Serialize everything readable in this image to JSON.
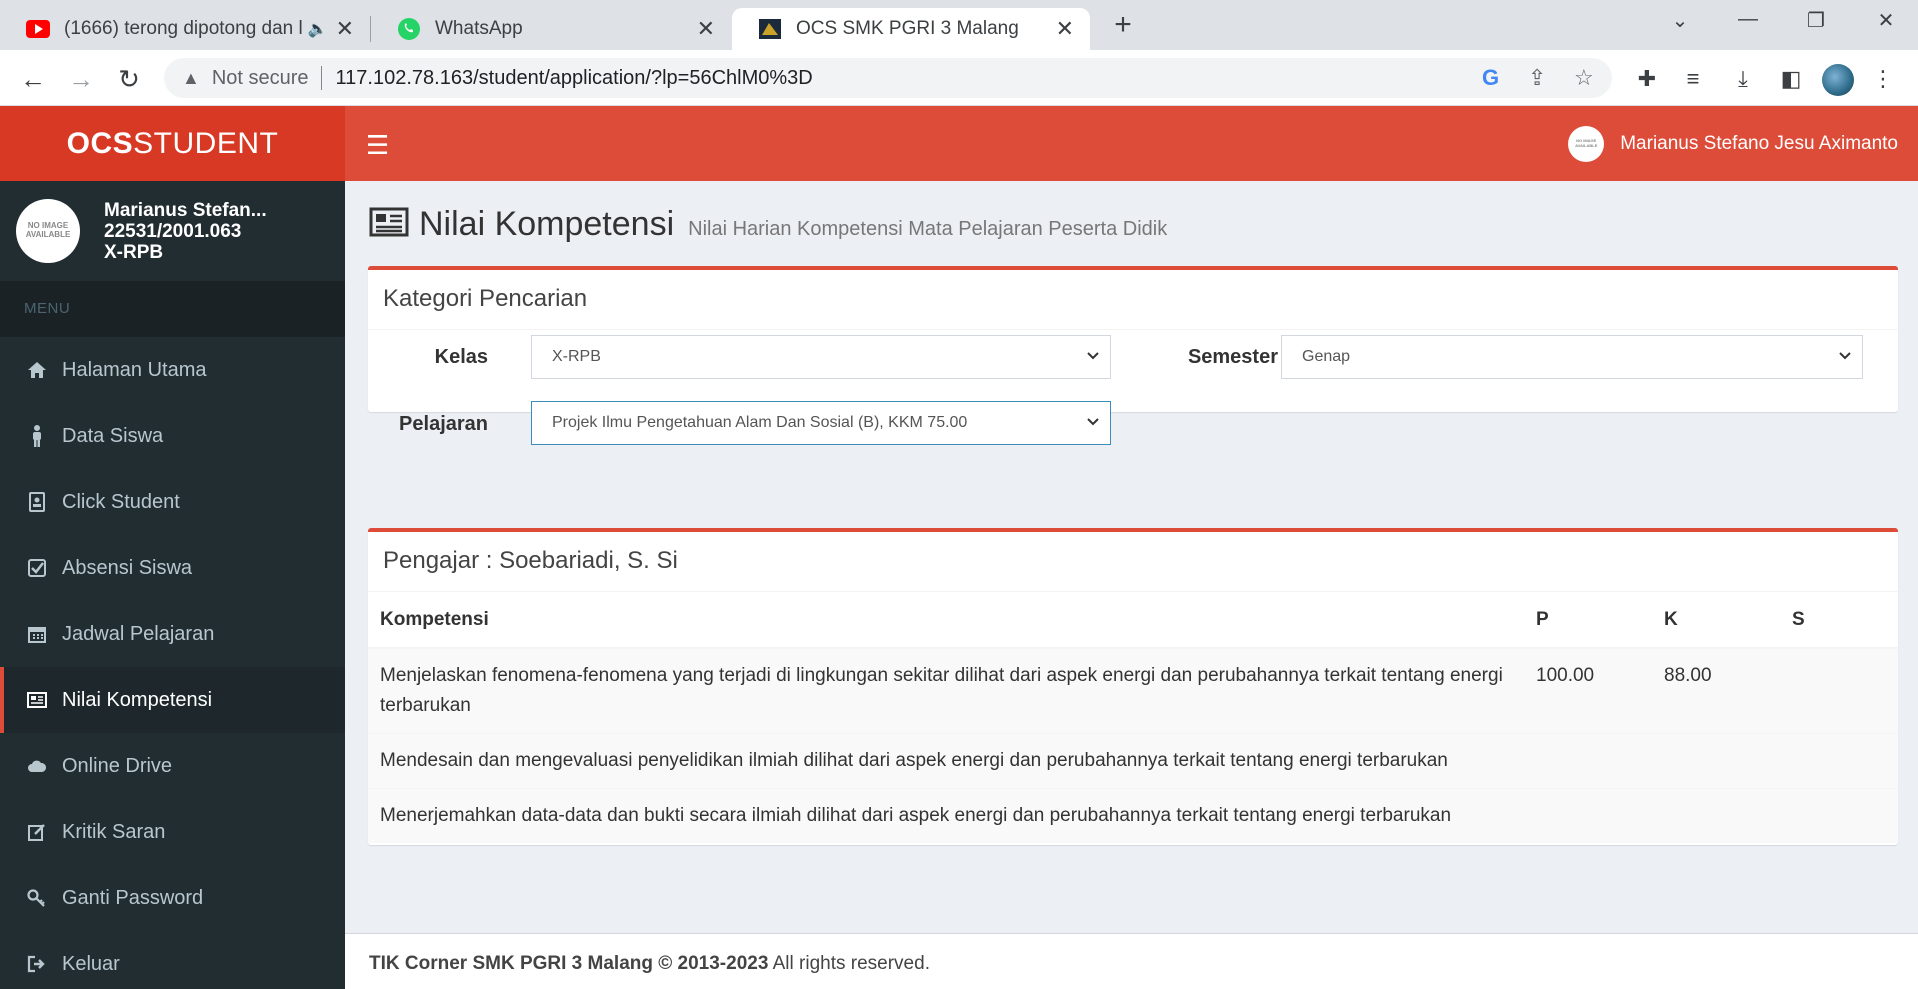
{
  "browser": {
    "tabs": [
      {
        "title": "(1666) terong dipotong dan l",
        "icon": "youtube-icon"
      },
      {
        "title": "WhatsApp",
        "icon": "whatsapp-icon"
      },
      {
        "title": "OCS SMK PGRI 3 Malang",
        "icon": "ocs-favicon"
      }
    ],
    "security_label": "Not secure",
    "url": "117.102.78.163/student/application/?lp=56ChlM0%3D"
  },
  "header": {
    "logo_bold": "OCS",
    "logo_rest": "STUDENT",
    "user_name": "Marianus Stefano Jesu Aximanto",
    "avatar_text": "NO IMAGE AVAILABLE"
  },
  "sidebar": {
    "user": {
      "name": "Marianus Stefan...",
      "nis": "22531/2001.063",
      "class": "X-RPB",
      "avatar_text": "NO IMAGE AVAILABLE"
    },
    "menu_header": "MENU",
    "items": [
      {
        "label": "Halaman Utama",
        "icon": "home-icon"
      },
      {
        "label": "Data Siswa",
        "icon": "person-icon"
      },
      {
        "label": "Click Student",
        "icon": "id-card-icon"
      },
      {
        "label": "Absensi Siswa",
        "icon": "check-square-icon"
      },
      {
        "label": "Jadwal Pelajaran",
        "icon": "calendar-icon"
      },
      {
        "label": "Nilai Kompetensi",
        "icon": "newspaper-icon"
      },
      {
        "label": "Online Drive",
        "icon": "cloud-icon"
      },
      {
        "label": "Kritik Saran",
        "icon": "edit-icon"
      },
      {
        "label": "Ganti Password",
        "icon": "key-icon"
      },
      {
        "label": "Keluar",
        "icon": "sign-out-icon"
      }
    ],
    "active_item": "Nilai Kompetensi"
  },
  "page": {
    "title": "Nilai Kompetensi",
    "subtitle": "Nilai Harian Kompetensi Mata Pelajaran Peserta Didik"
  },
  "search_box": {
    "title": "Kategori Pencarian",
    "kelas_label": "Kelas",
    "kelas_value": "X-RPB",
    "semester_label": "Semester",
    "semester_value": "Genap",
    "pelajaran_label": "Pelajaran",
    "pelajaran_value": "Projek Ilmu Pengetahuan Alam Dan Sosial (B), KKM 75.00"
  },
  "result_box": {
    "title": "Pengajar : Soebariadi, S. Si",
    "columns": [
      "Kompetensi",
      "P",
      "K",
      "S"
    ],
    "rows": [
      {
        "kompetensi": "Menjelaskan fenomena-fenomena yang terjadi di lingkungan sekitar dilihat dari aspek energi dan perubahannya terkait tentang energi terbarukan",
        "p": "100.00",
        "k": "88.00",
        "s": ""
      },
      {
        "kompetensi": "Mendesain dan mengevaluasi penyelidikan ilmiah dilihat dari aspek energi dan perubahannya terkait tentang energi terbarukan",
        "p": "",
        "k": "",
        "s": ""
      },
      {
        "kompetensi": "Menerjemahkan data-data dan bukti secara ilmiah dilihat dari aspek energi dan perubahannya terkait tentang energi terbarukan",
        "p": "",
        "k": "",
        "s": ""
      }
    ]
  },
  "footer": {
    "bold": "TIK Corner SMK PGRI 3 Malang © 2013-2023",
    "rest": " All rights reserved."
  },
  "colors": {
    "header_red": "#dd4b39",
    "logo_red": "#d73925",
    "sidebar_dark": "#222d32"
  }
}
